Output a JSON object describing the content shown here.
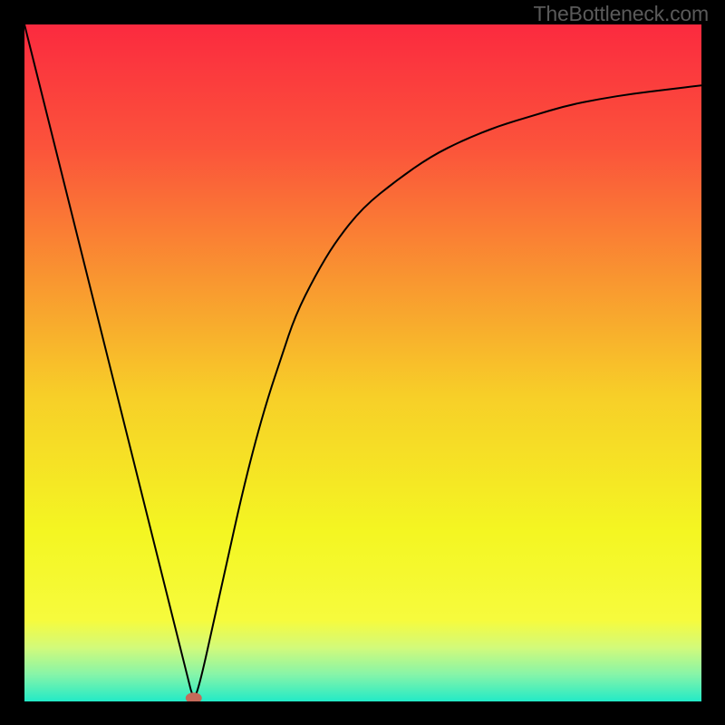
{
  "watermark": "TheBottleneck.com",
  "chart_data": {
    "type": "line",
    "title": "",
    "xlabel": "",
    "ylabel": "",
    "xlim": [
      0,
      100
    ],
    "ylim": [
      0,
      100
    ],
    "grid": false,
    "background_gradient": {
      "type": "vertical",
      "stops": [
        {
          "pos": 0.0,
          "color": "#fb2a3f"
        },
        {
          "pos": 0.18,
          "color": "#fb533b"
        },
        {
          "pos": 0.38,
          "color": "#f99730"
        },
        {
          "pos": 0.55,
          "color": "#f7cf28"
        },
        {
          "pos": 0.75,
          "color": "#f4f622"
        },
        {
          "pos": 0.88,
          "color": "#f6fb3d"
        },
        {
          "pos": 0.92,
          "color": "#d3fa7a"
        },
        {
          "pos": 0.96,
          "color": "#87f5a8"
        },
        {
          "pos": 1.0,
          "color": "#22eac7"
        }
      ]
    },
    "series": [
      {
        "name": "curve",
        "color": "#000000",
        "width": 2,
        "x": [
          0,
          2,
          4,
          6,
          8,
          10,
          12,
          14,
          16,
          18,
          20,
          22,
          24,
          25,
          26,
          28,
          30,
          32,
          34,
          36,
          38,
          40,
          43,
          46,
          50,
          55,
          60,
          65,
          70,
          75,
          80,
          85,
          90,
          95,
          100
        ],
        "y": [
          100,
          92,
          84,
          76,
          68,
          60,
          52,
          44,
          36,
          28,
          20,
          12,
          4,
          0,
          3,
          12,
          21,
          30,
          38,
          45,
          51,
          57,
          63,
          68,
          73,
          77,
          80.5,
          83,
          85,
          86.5,
          88,
          89,
          89.8,
          90.4,
          91
        ]
      }
    ],
    "markers": [
      {
        "name": "minimum-dot",
        "x": 25,
        "y": 0.5,
        "rx": 1.2,
        "ry": 0.8,
        "color": "#c56a5a"
      }
    ]
  }
}
